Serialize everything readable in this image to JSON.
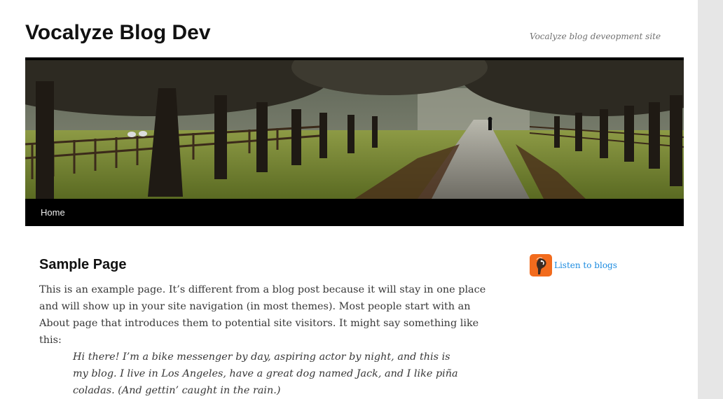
{
  "site": {
    "title": "Vocalyze Blog Dev",
    "description": "Vocalyze blog deveopment site"
  },
  "header_image": {
    "alt": "tree-lined path header image"
  },
  "nav": {
    "items": [
      {
        "label": "Home"
      }
    ]
  },
  "post": {
    "title": "Sample Page",
    "paragraph": "This is an example page. It’s different from a blog post because it will stay in one place and will show up in your site navigation (in most themes). Most people start with an About page that introduces them to potential site visitors. It might say something like this:",
    "quote": "Hi there! I’m a bike messenger by day, aspiring actor by night, and this is my blog. I live in Los Angeles, have a great dog named Jack, and I like piña coladas. (And gettin’ caught in the rain.)"
  },
  "sidebar": {
    "widget": {
      "icon": "vocalyze-parrot-icon",
      "label": "Listen to blogs"
    }
  },
  "colors": {
    "nav_bg": "#000000",
    "link": "#1b8be0",
    "widget_icon_bg": "#f26b1d",
    "page_bg": "#e6e6e6"
  }
}
